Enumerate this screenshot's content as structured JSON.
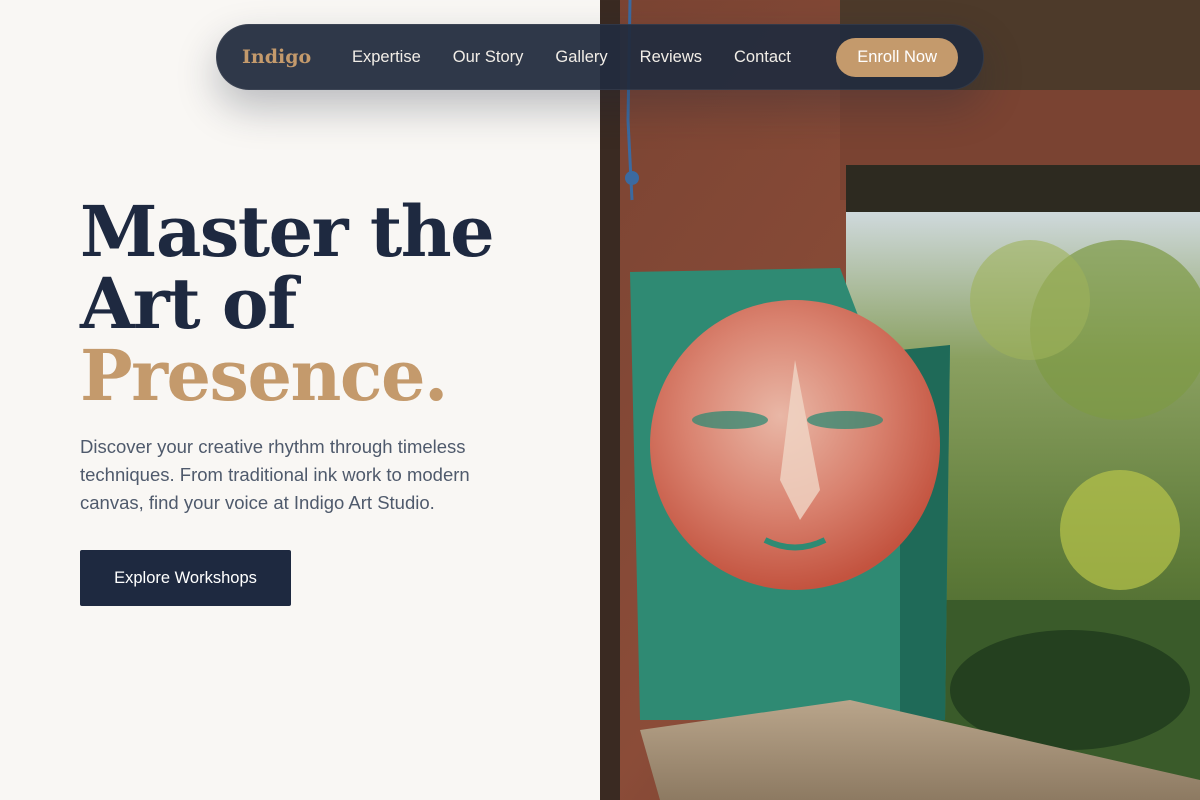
{
  "nav": {
    "brand": "Indigo",
    "links": [
      {
        "label": "Expertise"
      },
      {
        "label": "Our Story"
      },
      {
        "label": "Gallery"
      },
      {
        "label": "Reviews"
      },
      {
        "label": "Contact"
      }
    ],
    "cta_label": "Enroll Now"
  },
  "hero": {
    "headline_line1": "Master the",
    "headline_line2": "Art of",
    "headline_accent": "Presence.",
    "description": "Discover your creative rhythm through timeless techniques. From traditional ink work to modern canvas, find your voice at Indigo Art Studio.",
    "cta_label": "Explore Workshops"
  },
  "colors": {
    "background": "#f9f7f4",
    "navy": "#1e2940",
    "accent_gold": "#c49a6c",
    "body_text": "#4f5a6c"
  }
}
